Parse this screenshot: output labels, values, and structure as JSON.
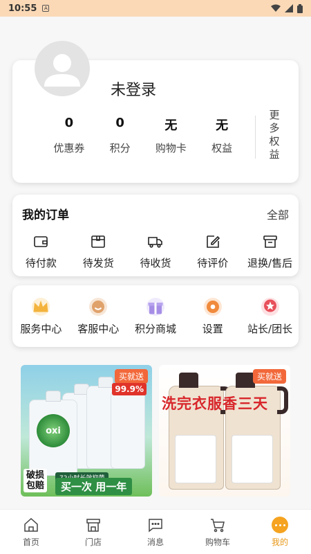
{
  "status_bar": {
    "time": "10:55",
    "notification_icon": "A"
  },
  "profile": {
    "username": "未登录",
    "stats": [
      {
        "value": "0",
        "label": "优惠券"
      },
      {
        "value": "0",
        "label": "积分"
      },
      {
        "value": "无",
        "label": "购物卡"
      },
      {
        "value": "无",
        "label": "权益"
      }
    ],
    "more_label": "更多权益"
  },
  "orders": {
    "title": "我的订单",
    "all_label": "全部",
    "items": [
      {
        "label": "待付款",
        "icon": "wallet-icon"
      },
      {
        "label": "待发货",
        "icon": "package-icon"
      },
      {
        "label": "待收货",
        "icon": "truck-icon"
      },
      {
        "label": "待评价",
        "icon": "edit-icon"
      },
      {
        "label": "退换/售后",
        "icon": "return-box-icon"
      }
    ]
  },
  "services": {
    "items": [
      {
        "label": "服务中心",
        "icon": "crown-icon",
        "color": "#f3b33d"
      },
      {
        "label": "客服中心",
        "icon": "customer-service-icon",
        "color": "#e0a26b"
      },
      {
        "label": "积分商城",
        "icon": "gift-icon",
        "color": "#a68ee6"
      },
      {
        "label": "设置",
        "icon": "gear-icon",
        "color": "#f08a3c"
      },
      {
        "label": "站长/团长",
        "icon": "medal-icon",
        "color": "#e8505b"
      }
    ]
  },
  "banners": {
    "left": {
      "tag": "买就送",
      "percent": "99.9%",
      "bottle_label": "oxi",
      "badge": "破损\n包赔",
      "strip_text": "72小时长效抑菌",
      "cta": "买一次 用一年"
    },
    "right": {
      "tag": "买就送",
      "title": "洗完衣服香三天"
    }
  },
  "tab_bar": {
    "items": [
      {
        "label": "首页",
        "icon": "home-icon"
      },
      {
        "label": "门店",
        "icon": "store-icon"
      },
      {
        "label": "消息",
        "icon": "message-icon"
      },
      {
        "label": "购物车",
        "icon": "cart-icon"
      },
      {
        "label": "我的",
        "icon": "profile-dots-icon"
      }
    ],
    "active_index": 4
  },
  "colors": {
    "accent": "#f5a320",
    "status_bar_bg": "#fbd9b6",
    "tag_bg": "#f2683a"
  }
}
